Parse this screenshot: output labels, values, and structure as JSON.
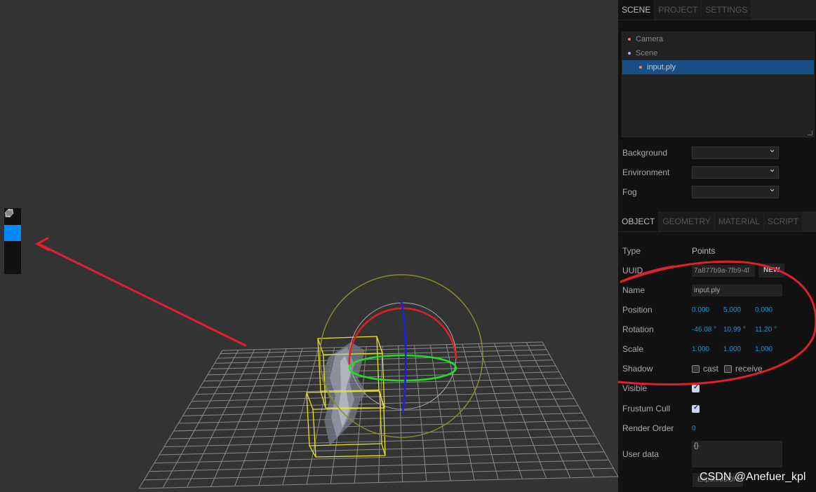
{
  "sidebar": {
    "top_tabs": [
      {
        "label": "SCENE",
        "selected": true
      },
      {
        "label": "PROJECT",
        "selected": false
      },
      {
        "label": "SETTINGS",
        "selected": false
      }
    ],
    "outliner": [
      {
        "label": "Camera",
        "dot_color": "#ee7777"
      },
      {
        "label": "Scene",
        "dot_color": "#aaaaee"
      },
      {
        "label": "input.ply",
        "dot_color": "#ee7777"
      }
    ],
    "scene_props": {
      "background_label": "Background",
      "environment_label": "Environment",
      "fog_label": "Fog"
    },
    "object_tabs": [
      {
        "label": "OBJECT",
        "selected": true
      },
      {
        "label": "GEOMETRY",
        "selected": false
      },
      {
        "label": "MATERIAL",
        "selected": false
      },
      {
        "label": "SCRIPT",
        "selected": false
      }
    ],
    "object": {
      "type_label": "Type",
      "type_value": "Points",
      "uuid_label": "UUID",
      "uuid_value": "7a877b9a-7fb9-4f",
      "new_label": "NEW",
      "name_label": "Name",
      "name_value": "input.ply",
      "position_label": "Position",
      "position": [
        "0.000",
        "5.000",
        "0.000"
      ],
      "rotation_label": "Rotation",
      "rotation": [
        "-46.08 °",
        "10.99 °",
        "11.20 °"
      ],
      "scale_label": "Scale",
      "scale": [
        "1.000",
        "1.000",
        "1.000"
      ],
      "shadow_label": "Shadow",
      "cast_label": "cast",
      "receive_label": "receive",
      "visible_label": "Visible",
      "frustum_label": "Frustum Cull",
      "render_order_label": "Render Order",
      "render_order_value": "0",
      "user_data_label": "User data",
      "user_data_value": "{}",
      "export_label": "Export JSON"
    }
  },
  "toolbar": {
    "tools": [
      {
        "name": "translate",
        "active": false
      },
      {
        "name": "rotate",
        "active": true
      },
      {
        "name": "scale",
        "active": false
      },
      {
        "name": "local",
        "active": false
      }
    ]
  },
  "watermark": "CSDN @Anefuer_kpl",
  "colors": {
    "accent": "#0088ff",
    "annotation": "#e0202a",
    "selection": "#194f84",
    "number": "#2194ce"
  }
}
